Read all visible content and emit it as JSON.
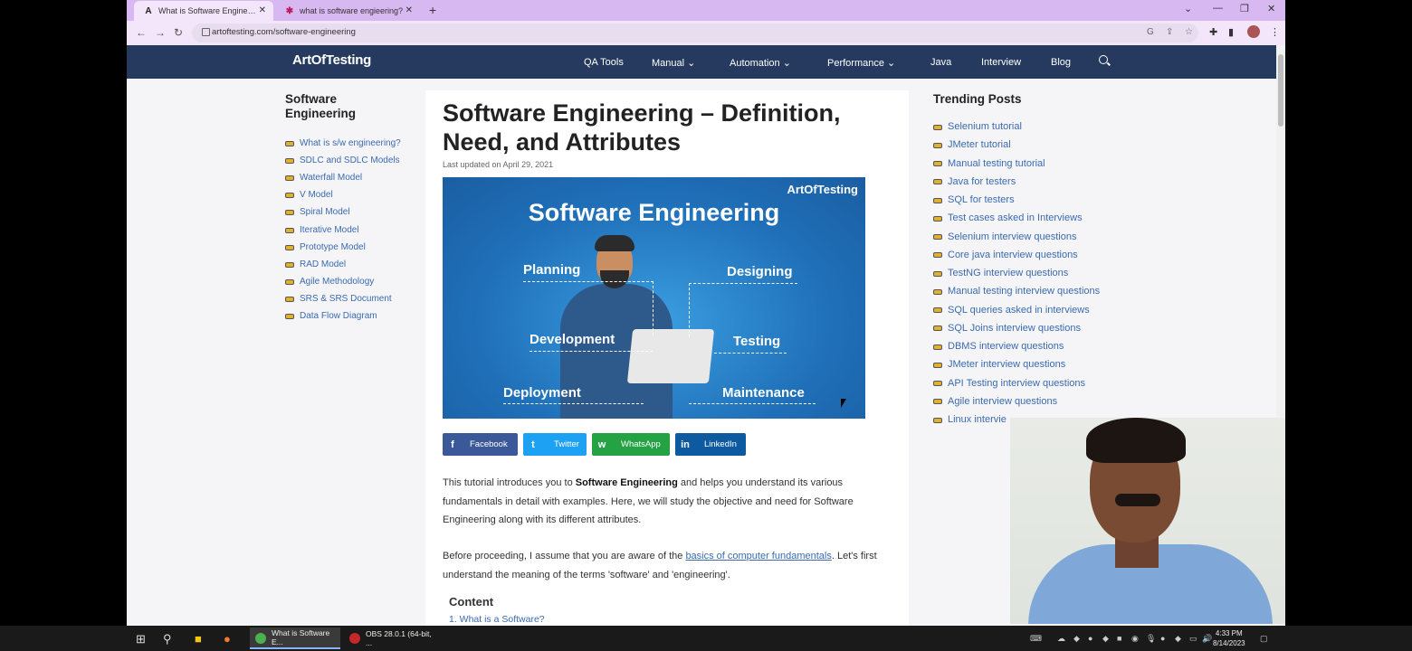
{
  "browser": {
    "tabs": [
      {
        "title": "What is Software Engineering? D",
        "favicon": "A",
        "active": true
      },
      {
        "title": "what is software engieering?",
        "favicon": "✱",
        "active": false
      }
    ],
    "url": "artoftesting.com/software-engineering"
  },
  "site": {
    "logo": "ArtOfTesting",
    "nav": [
      "QA Tools",
      "Manual",
      "Automation",
      "Performance",
      "Java",
      "Interview",
      "Blog"
    ]
  },
  "sidebar": {
    "title": "Software Engineering",
    "items": [
      "What is s/w engineering?",
      "SDLC and SDLC Models",
      "Waterfall Model",
      "V Model",
      "Spiral Model",
      "Iterative Model",
      "Prototype Model",
      "RAD Model",
      "Agile Methodology",
      "SRS & SRS Document",
      "Data Flow Diagram"
    ]
  },
  "article": {
    "title": "Software Engineering – Definition, Need, and Attributes",
    "updated": "Last updated on April 29, 2021",
    "hero": {
      "brand": "ArtOfTesting",
      "title": "Software Engineering",
      "labels": [
        "Planning",
        "Designing",
        "Development",
        "Testing",
        "Deployment",
        "Maintenance"
      ]
    },
    "share": [
      {
        "name": "Facebook",
        "color": "#3b5998",
        "icon": "f"
      },
      {
        "name": "Twitter",
        "color": "#1da1f2",
        "icon": "t"
      },
      {
        "name": "WhatsApp",
        "color": "#25a244",
        "icon": "w"
      },
      {
        "name": "LinkedIn",
        "color": "#0e5aa0",
        "icon": "in"
      }
    ],
    "p1_a": "This tutorial introduces you to ",
    "p1_b": "Software Engineering",
    "p1_c": " and helps you understand its various fundamentals in detail with examples. Here, we will study the objective and need for Software Engineering along with its different attributes.",
    "p2_a": "Before proceeding, I assume that you are aware of the ",
    "p2_link": "basics of computer fundamentals",
    "p2_c": ". Let's first understand the meaning of the terms 'software' and 'engineering'.",
    "content_heading": "Content",
    "content_first": "1. What is a Software?"
  },
  "trending": {
    "title": "Trending Posts",
    "items": [
      "Selenium tutorial",
      "JMeter tutorial",
      "Manual testing tutorial",
      "Java for testers",
      "SQL for testers",
      "Test cases asked in Interviews",
      "Selenium interview questions",
      "Core java interview questions",
      "TestNG interview questions",
      "Manual testing interview questions",
      "SQL queries asked in interviews",
      "SQL Joins interview questions",
      "DBMS interview questions",
      "JMeter interview questions",
      "API Testing interview questions",
      "Agile interview questions",
      "Linux intervie"
    ]
  },
  "taskbar": {
    "apps": [
      {
        "label": "What is Software E...",
        "active": true,
        "color": "#4caf50"
      },
      {
        "label": "OBS 28.0.1 (64-bit, ...",
        "active": false,
        "color": "#c62828"
      }
    ],
    "time": "4:33 PM",
    "date": "8/14/2023"
  }
}
